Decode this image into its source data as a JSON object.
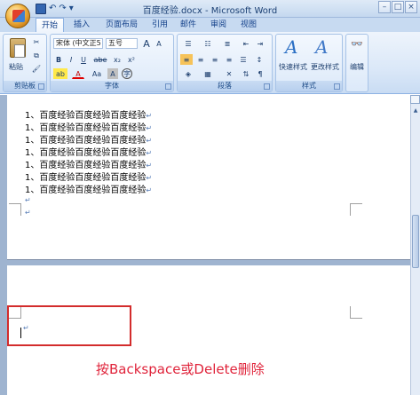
{
  "window": {
    "title": "百度经验.docx - Microsoft Word",
    "controls": [
      "–",
      "□",
      "×"
    ]
  },
  "quick_access": [
    "↶",
    "↷"
  ],
  "tabs": [
    {
      "label": "开始",
      "active": true
    },
    {
      "label": "插入",
      "active": false
    },
    {
      "label": "页面布局",
      "active": false
    },
    {
      "label": "引用",
      "active": false
    },
    {
      "label": "邮件",
      "active": false
    },
    {
      "label": "审阅",
      "active": false
    },
    {
      "label": "视图",
      "active": false
    }
  ],
  "ribbon": {
    "clipboard": {
      "label": "剪贴板",
      "paste": "粘贴",
      "cut": "✂",
      "copy": "⧉",
      "format_painter": "🖌"
    },
    "font": {
      "label": "字体",
      "font_name": "宋体 (中文正5",
      "font_size": "五号",
      "grow": "A",
      "shrink": "A",
      "bold": "B",
      "italic": "I",
      "underline": "U",
      "strike": "abe",
      "subscript": "x₂",
      "superscript": "x²",
      "highlight": "ab",
      "font_color": "A",
      "change_case": "Aa",
      "char_shading": "A",
      "enclose": "字"
    },
    "paragraph": {
      "label": "段落"
    },
    "styles": {
      "label": "样式",
      "quick_styles": "快速样式",
      "change_styles": "更改样式"
    },
    "editing": {
      "label": "编辑"
    }
  },
  "document": {
    "lines": [
      "1、百度经验百度经验百度经验",
      "1、百度经验百度经验百度经验",
      "1、百度经验百度经验百度经验",
      "1、百度经验百度经验百度经验",
      "1、百度经验百度经验百度经验",
      "1、百度经验百度经验百度经验",
      "1、百度经验百度经验百度经验"
    ],
    "paragraph_mark": "↵",
    "instruction": "按Backspace或Delete删除"
  },
  "colors": {
    "highlight_box": "#d32c2c",
    "instruction_text": "#e0243b",
    "ribbon_bg": "#dbe8f8"
  }
}
